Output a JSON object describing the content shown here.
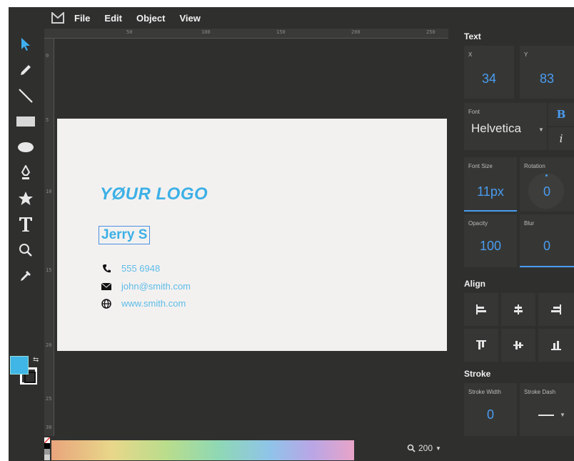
{
  "menu": {
    "items": [
      "File",
      "Edit",
      "Object",
      "View"
    ]
  },
  "toolbar": {
    "tools": [
      "select-tool",
      "pencil-tool",
      "line-tool",
      "rectangle-tool",
      "ellipse-tool",
      "pen-tool",
      "star-tool",
      "text-tool",
      "zoom-tool",
      "eyedropper-tool"
    ],
    "fill_color": "#3fb6e6",
    "swap_symbol": "⇆"
  },
  "ruler": {
    "top_ticks": [
      "50",
      "100",
      "150",
      "200",
      "250"
    ],
    "left_ticks": [
      "0",
      "5",
      "10",
      "15",
      "20",
      "25",
      "30"
    ]
  },
  "card": {
    "logo": "YØUR LOGO",
    "name": "Jerry S",
    "phone": "555 6948",
    "email": "john@smith.com",
    "website": "www.smith.com",
    "accent": "#3cb0e6"
  },
  "bottom": {
    "zoom_value": "200"
  },
  "panel": {
    "text_title": "Text",
    "x_label": "X",
    "x_value": "34",
    "y_label": "Y",
    "y_value": "83",
    "font_label": "Font",
    "font_value": "Helvetica",
    "bold_label": "B",
    "italic_label": "i",
    "font_size_label": "Font Size",
    "font_size_value": "11px",
    "rotation_label": "Rotation",
    "rotation_value": "0",
    "opacity_label": "Opacity",
    "opacity_value": "100",
    "blur_label": "Blur",
    "blur_value": "0",
    "align_title": "Align",
    "stroke_title": "Stroke",
    "stroke_width_label": "Stroke Width",
    "stroke_width_value": "0",
    "stroke_dash_label": "Stroke Dash",
    "value_color": "#4a9cf0"
  }
}
